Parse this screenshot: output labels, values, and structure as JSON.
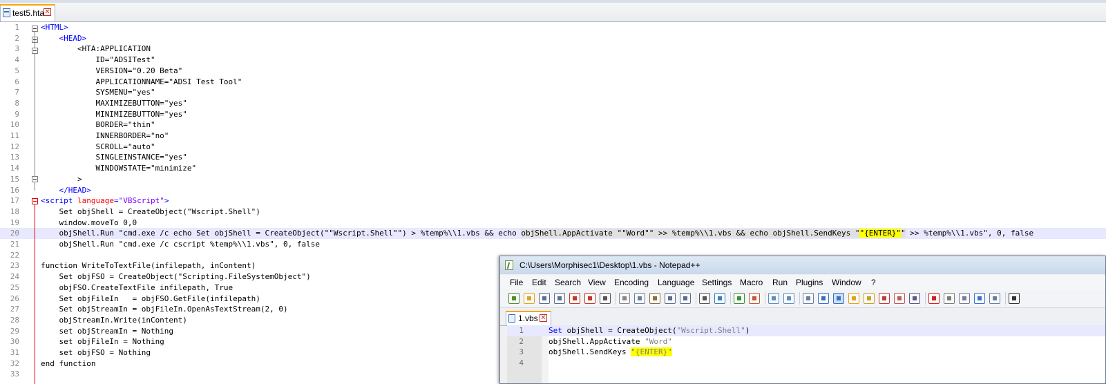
{
  "main_tab": {
    "label": "test5.hta",
    "close": "✕"
  },
  "main_lines": [
    {
      "n": "1",
      "segs": [
        {
          "t": "<HTML>",
          "c": "tag"
        }
      ]
    },
    {
      "n": "2",
      "segs": [
        {
          "t": "    "
        },
        {
          "t": "<HEAD>",
          "c": "tag"
        }
      ]
    },
    {
      "n": "3",
      "segs": [
        {
          "t": "        <HTA:APPLICATION"
        }
      ]
    },
    {
      "n": "4",
      "segs": [
        {
          "t": "            ID=\"ADSITest\""
        }
      ]
    },
    {
      "n": "5",
      "segs": [
        {
          "t": "            VERSION=\"0.20 Beta\""
        }
      ]
    },
    {
      "n": "6",
      "segs": [
        {
          "t": "            APPLICATIONNAME=\"ADSI Test Tool\""
        }
      ]
    },
    {
      "n": "7",
      "segs": [
        {
          "t": "            SYSMENU=\"yes\""
        }
      ]
    },
    {
      "n": "8",
      "segs": [
        {
          "t": "            MAXIMIZEBUTTON=\"yes\""
        }
      ]
    },
    {
      "n": "9",
      "segs": [
        {
          "t": "            MINIMIZEBUTTON=\"yes\""
        }
      ]
    },
    {
      "n": "10",
      "segs": [
        {
          "t": "            BORDER=\"thin\""
        }
      ]
    },
    {
      "n": "11",
      "segs": [
        {
          "t": "            INNERBORDER=\"no\""
        }
      ]
    },
    {
      "n": "12",
      "segs": [
        {
          "t": "            SCROLL=\"auto\""
        }
      ]
    },
    {
      "n": "13",
      "segs": [
        {
          "t": "            SINGLEINSTANCE=\"yes\""
        }
      ]
    },
    {
      "n": "14",
      "segs": [
        {
          "t": "            WINDOWSTATE=\"minimize\""
        }
      ]
    },
    {
      "n": "15",
      "segs": [
        {
          "t": "        >"
        }
      ]
    },
    {
      "n": "16",
      "segs": [
        {
          "t": "    "
        },
        {
          "t": "</HEAD>",
          "c": "tag"
        }
      ]
    },
    {
      "n": "17",
      "segs": [
        {
          "t": "<script ",
          "c": "tag"
        },
        {
          "t": "language",
          "c": "attr"
        },
        {
          "t": "=",
          "c": "tag"
        },
        {
          "t": "\"VBScript\"",
          "c": "str"
        },
        {
          "t": ">",
          "c": "tag"
        }
      ]
    },
    {
      "n": "18",
      "segs": [
        {
          "t": "    Set objShell = CreateObject(\"Wscript.Shell\")"
        }
      ]
    },
    {
      "n": "19",
      "segs": [
        {
          "t": "    window.moveTo 0,0"
        }
      ]
    },
    {
      "n": "20",
      "cur": true,
      "segs": [
        {
          "t": "    objShell.Run \"cmd.exe /c echo Set objShell = CreateObject(\"\"Wscript.Shell\"\") > %temp%\\\\1.vbs && echo "
        },
        {
          "t": "objShell.AppActivate \"\"Word\"\" >> %temp%\\\\1.vbs && echo objShell.SendKeys \"",
          "c": "sel"
        },
        {
          "t": "\"{ENTER}\"",
          "c": "hl"
        },
        {
          "t": "\"",
          "c": "sel"
        },
        {
          "t": " >> %temp%\\\\1.vbs\", 0, false"
        }
      ]
    },
    {
      "n": "21",
      "segs": [
        {
          "t": "    objShell.Run \"cmd.exe /c cscript %temp%\\\\1.vbs\", 0, false"
        }
      ]
    },
    {
      "n": "22",
      "segs": [
        {
          "t": ""
        }
      ]
    },
    {
      "n": "23",
      "segs": [
        {
          "t": "function WriteToTextFile(infilepath, inContent)"
        }
      ]
    },
    {
      "n": "24",
      "segs": [
        {
          "t": "    Set objFSO = CreateObject(\"Scripting.FileSystemObject\")"
        }
      ]
    },
    {
      "n": "25",
      "segs": [
        {
          "t": "    objFSO.CreateTextFile infilepath, True"
        }
      ]
    },
    {
      "n": "26",
      "segs": [
        {
          "t": "    Set objFileIn   = objFSO.GetFile(infilepath)"
        }
      ]
    },
    {
      "n": "27",
      "segs": [
        {
          "t": "    Set objStreamIn = objFileIn.OpenAsTextStream(2, 0)"
        }
      ]
    },
    {
      "n": "28",
      "segs": [
        {
          "t": "    objStreamIn.Write(inContent)"
        }
      ]
    },
    {
      "n": "29",
      "segs": [
        {
          "t": "    set objStreamIn = Nothing"
        }
      ]
    },
    {
      "n": "30",
      "segs": [
        {
          "t": "    set objFileIn = Nothing"
        }
      ]
    },
    {
      "n": "31",
      "segs": [
        {
          "t": "    set objFSO = Nothing"
        }
      ]
    },
    {
      "n": "32",
      "segs": [
        {
          "t": "end function"
        }
      ]
    },
    {
      "n": "33",
      "segs": [
        {
          "t": ""
        }
      ]
    }
  ],
  "notepad": {
    "title": "C:\\Users\\Morphisec1\\Desktop\\1.vbs - Notepad++",
    "menu": [
      "File",
      "Edit",
      "Search",
      "View",
      "Encoding",
      "Language",
      "Settings",
      "Macro",
      "Run",
      "Plugins",
      "Window",
      "?"
    ],
    "tab": {
      "label": "1.vbs",
      "close": "✕"
    },
    "lines": [
      {
        "n": "1",
        "cur": true,
        "segs": [
          {
            "t": "Set",
            "c": "kw"
          },
          {
            "t": " objShell = CreateObject("
          },
          {
            "t": "\"Wscript.Shell\"",
            "c": "gstr"
          },
          {
            "t": ")"
          }
        ]
      },
      {
        "n": "2",
        "segs": [
          {
            "t": "objShell.AppActivate "
          },
          {
            "t": "\"Word\"",
            "c": "gstr"
          }
        ]
      },
      {
        "n": "3",
        "segs": [
          {
            "t": "objShell.SendKeys "
          },
          {
            "t": "\"{ENTER}\"",
            "c": "hl gstr"
          }
        ]
      },
      {
        "n": "4",
        "segs": [
          {
            "t": ""
          }
        ]
      }
    ],
    "toolbar_icons": [
      "new-file-icon",
      "open-file-icon",
      "save-icon",
      "save-all-icon",
      "close-icon",
      "close-all-icon",
      "print-icon",
      "cut-icon",
      "copy-icon",
      "paste-icon",
      "undo-icon",
      "redo-icon",
      "find-icon",
      "replace-icon",
      "zoom-in-icon",
      "zoom-out-icon",
      "sync-vertical-icon",
      "sync-horizontal-icon",
      "word-wrap-icon",
      "show-all-chars-icon",
      "indent-guide-icon",
      "user-lang-icon",
      "doc-map-icon",
      "function-list-icon",
      "folder-workspace-icon",
      "monitor-icon",
      "record-macro-icon",
      "stop-macro-icon",
      "play-macro-icon",
      "run-macro-multiple-icon",
      "save-macro-icon",
      "hex-icon"
    ]
  }
}
